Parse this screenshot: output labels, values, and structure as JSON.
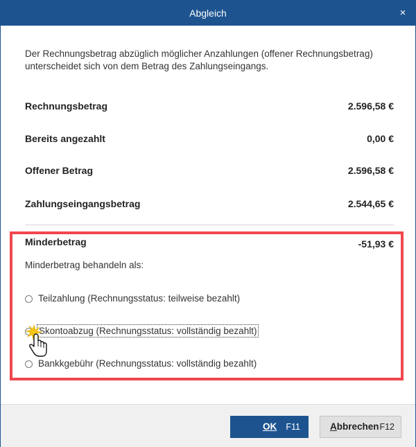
{
  "window": {
    "title": "Abgleich",
    "close_label": "×"
  },
  "intro_text": "Der Rechnungsbetrag abzüglich möglicher Anzahlungen (offener Rechnungsbetrag) unterscheidet sich von dem Betrag des Zahlungseingangs.",
  "summary": {
    "rows": [
      {
        "label": "Rechnungsbetrag",
        "value": "2.596,58 €"
      },
      {
        "label": "Bereits angezahlt",
        "value": "0,00 €"
      },
      {
        "label": "Offener Betrag",
        "value": "2.596,58 €"
      },
      {
        "label": "Zahlungseingangsbetrag",
        "value": "2.544,65 €"
      }
    ]
  },
  "difference": {
    "label": "Minderbetrag",
    "value": "-51,93 €",
    "handle_as_label": "Minderbetrag behandeln als:",
    "options": [
      {
        "label": "Teilzahlung (Rechnungsstatus: teilweise bezahlt)",
        "selected": false
      },
      {
        "label": "Skontoabzug (Rechnungsstatus: vollständig bezahlt)",
        "selected": false,
        "focused": true
      },
      {
        "label": "Bankkgebühr (Rechnungsstatus: vollständig bezahlt)",
        "selected": false
      }
    ]
  },
  "buttons": {
    "ok_label": "OK",
    "ok_key": "F11",
    "cancel_first": "A",
    "cancel_rest": "bbrechen",
    "cancel_key": "F12"
  },
  "colors": {
    "title_bar": "#1d5490",
    "ok_button": "#1d5490",
    "highlight_border": "#f0474f",
    "footer": "#f0f0f0"
  }
}
